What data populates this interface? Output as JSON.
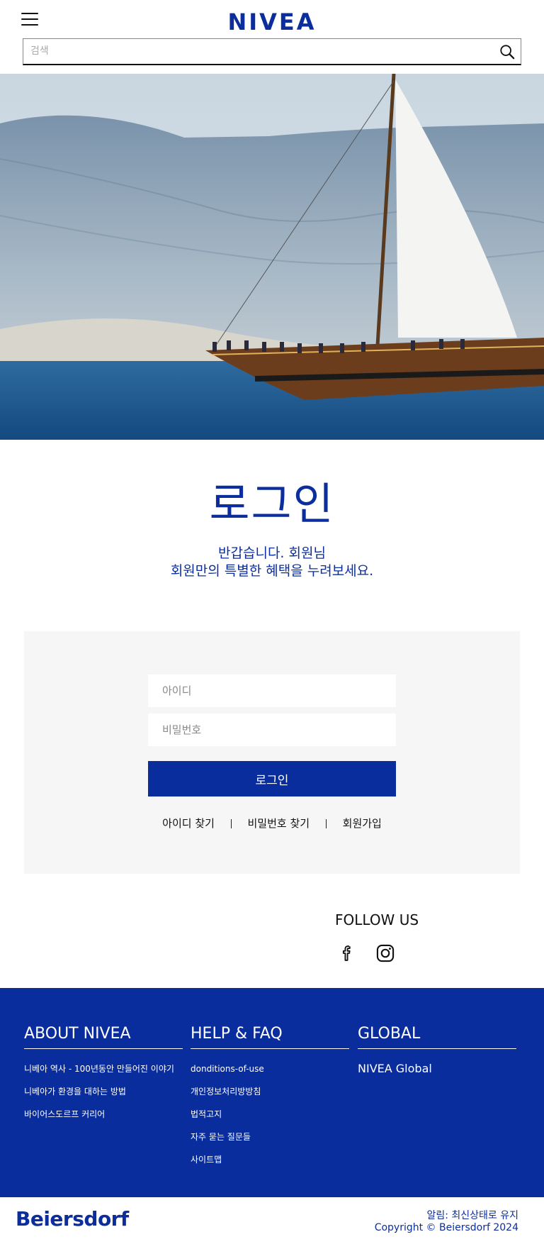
{
  "header": {
    "logo": "NIVEA",
    "search_placeholder": "검색"
  },
  "main": {
    "title": "로그인",
    "subtitle_line1": "반갑습니다. 회원님",
    "subtitle_line2": "회원만의 특별한 혜택을 누려보세요."
  },
  "login": {
    "id_placeholder": "아이디",
    "pw_placeholder": "비밀번호",
    "submit_label": "로그인",
    "links": [
      "아이디 찾기",
      "비밀번호 찾기",
      "회원가입"
    ]
  },
  "follow": {
    "title": "FOLLOW US",
    "icons": [
      "facebook-icon",
      "instagram-icon"
    ]
  },
  "footer": {
    "about": {
      "title": "ABOUT NIVEA",
      "items": [
        "니베아 역사 - 100년동안 만들어진 이야기",
        "니베아가 환경을 대하는 방법",
        "바이어스도르프 커리어"
      ]
    },
    "help": {
      "title": "HELP & FAQ",
      "items": [
        "donditions-of-use",
        "개인정보처리방방침",
        "법적고지",
        "자주 묻는 질문들",
        "사이트맵"
      ]
    },
    "global": {
      "title": "GLOBAL",
      "items": [
        "NIVEA Global"
      ]
    }
  },
  "bottom": {
    "logo": "Beiersdorf",
    "notice": "알림: 최신상태로 유지",
    "copyright": "Copyright © Beiersdorf 2024"
  },
  "colors": {
    "brand_blue": "#0a2d9e",
    "login_box_bg": "#f6f6f6"
  }
}
